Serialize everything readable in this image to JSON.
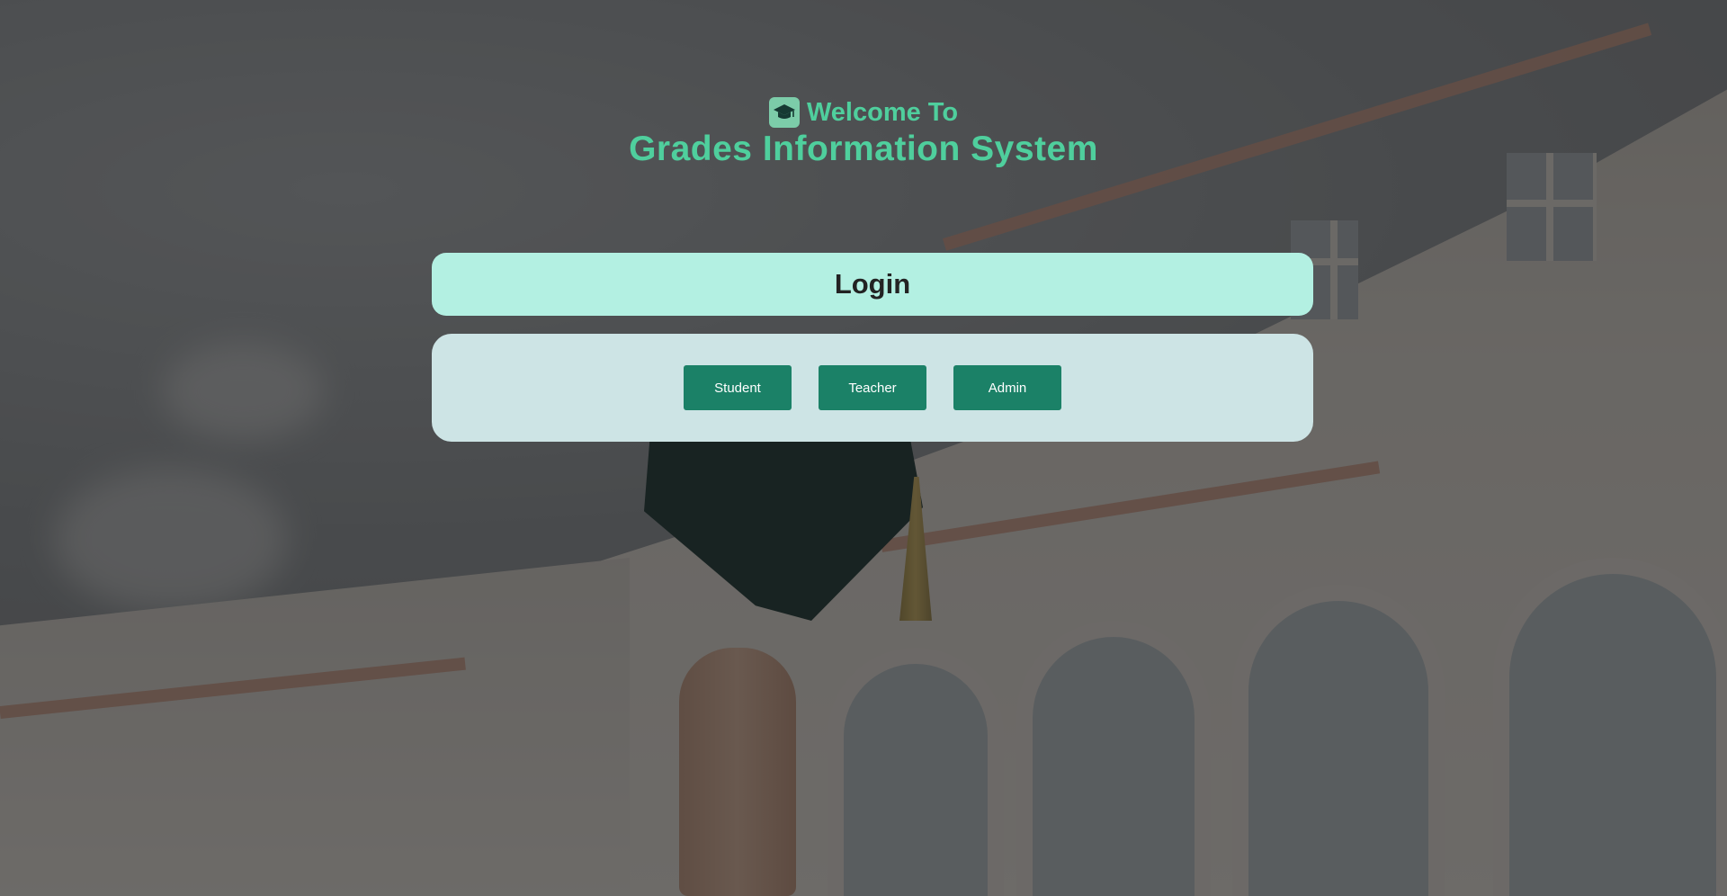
{
  "header": {
    "logo_icon": "graduation-cap-icon",
    "welcome": "Welcome To",
    "title": "Grades Information System"
  },
  "login": {
    "title": "Login"
  },
  "roles": [
    {
      "label": "Student"
    },
    {
      "label": "Teacher"
    },
    {
      "label": "Admin"
    }
  ],
  "colors": {
    "accent_text": "#4fcf9d",
    "login_bar": "#b3f0e2",
    "panel": "#cde4e5",
    "button": "#1b8167"
  }
}
